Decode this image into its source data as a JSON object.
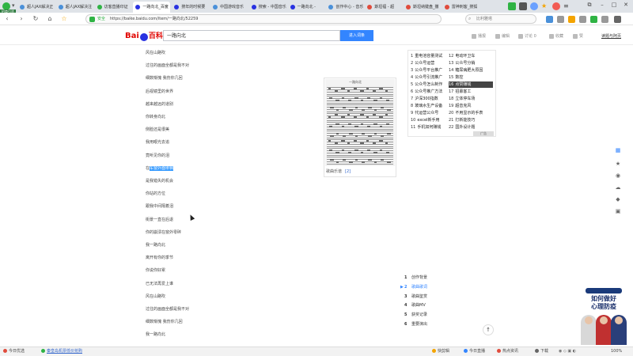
{
  "browser": {
    "badge": "招商引资",
    "tabs": [
      {
        "label": "超人JAX解决正",
        "active": false,
        "color": "#4a90d9"
      },
      {
        "label": "超人JAX解决注",
        "active": false,
        "color": "#4a90d9"
      },
      {
        "label": "访客直播印证",
        "active": false,
        "color": "#2fb344"
      },
      {
        "label": "一路向北_百度",
        "active": true,
        "color": "#2932e1"
      },
      {
        "label": "搜年的时候要",
        "active": false,
        "color": "#2932e1"
      },
      {
        "label": "中国游戏音乐",
        "active": false,
        "color": "#4a90d9"
      },
      {
        "label": "搜索 - 中国音乐",
        "active": false,
        "color": "#2932e1"
      },
      {
        "label": "一路向北 - ",
        "active": false,
        "color": "#2932e1"
      },
      {
        "label": "创作中心 - 音乐",
        "active": false,
        "color": "#4a90d9"
      },
      {
        "label": "斯坦福 - 超",
        "active": false,
        "color": "#e04b3c"
      },
      {
        "label": "斯坦纳键盘_撒",
        "active": false,
        "color": "#e04b3c"
      },
      {
        "label": "雷神刺客_搜狐",
        "active": false,
        "color": "#e04b3c"
      }
    ],
    "url_secure": "安全",
    "url": "https://baike.baidu.com/item/一路向北/52259",
    "search_placeholder": "比利雅塔"
  },
  "header": {
    "logo_bai": "Bai",
    "logo_bk": "百科",
    "search_value": "一路向北",
    "search_button": "进入词条",
    "actions": [
      "播报",
      "编辑",
      "讨论 0",
      "收藏",
      "赞"
    ],
    "help": "读题与阿页"
  },
  "lyrics": [
    {
      "text": "风在山路吹"
    },
    {
      "text": "过往的画面全都是我不对"
    },
    {
      "text": "细数惭愧 我伤你几回"
    },
    {
      "text": "后视镜里的世界"
    },
    {
      "text": "越来越远的道别"
    },
    {
      "text": "你转身向北"
    },
    {
      "text": "侧脸还是很美"
    },
    {
      "text": "我用眼光去追"
    },
    {
      "text": "竟听见你的泪"
    },
    {
      "text": "在车窗外面徘徊",
      "before": "在",
      "highlight": "车窗外面徘徊"
    },
    {
      "text": "是我错失的机会"
    },
    {
      "text": "你站的方位"
    },
    {
      "text": "跟我中间隔着泪"
    },
    {
      "text": "街景一直在后退"
    },
    {
      "text": "你的崩溃在窗外零碎"
    },
    {
      "text": "我一路向北"
    },
    {
      "text": "离开有你的季节"
    },
    {
      "text": "你说你好累"
    },
    {
      "text": "已无法再爱上谁"
    },
    {
      "text": "风在山路吹"
    },
    {
      "text": "过往的画面全都是我不对"
    },
    {
      "text": "细数惭愧 我伤你几回"
    },
    {
      "text": "我一路向北"
    }
  ],
  "sheet": {
    "title": "一路向北",
    "caption": "歌曲乐谱",
    "cite": "[2]"
  },
  "hotlist": {
    "left": [
      {
        "num": "1",
        "label": "重电池容量测试"
      },
      {
        "num": "2",
        "label": "公众号运营"
      },
      {
        "num": "3",
        "label": "公众号平台推广"
      },
      {
        "num": "4",
        "label": "公众号引流推广"
      },
      {
        "num": "5",
        "label": "公众号怎么制作"
      },
      {
        "num": "6",
        "label": "公众号推广方法"
      },
      {
        "num": "7",
        "label": "沪深300指数"
      },
      {
        "num": "8",
        "label": "玻璃水生产设备"
      },
      {
        "num": "9",
        "label": "代运营公众号"
      },
      {
        "num": "10",
        "label": "excel新手用"
      },
      {
        "num": "11",
        "label": "手机如何赚钱"
      }
    ],
    "right": [
      {
        "num": "12",
        "label": "电动环卫车"
      },
      {
        "num": "13",
        "label": "公众号分销"
      },
      {
        "num": "14",
        "label": "糖尿病肥大原因"
      },
      {
        "num": "15",
        "label": "数控"
      },
      {
        "num": "16",
        "label": "点赞赚钱",
        "hilite": true
      },
      {
        "num": "17",
        "label": "招募客工"
      },
      {
        "num": "18",
        "label": "立体停车场"
      },
      {
        "num": "19",
        "label": "超音克风"
      },
      {
        "num": "20",
        "label": "不用显示的手表"
      },
      {
        "num": "21",
        "label": "打新能技巧"
      },
      {
        "num": "22",
        "label": "国外设计题"
      }
    ],
    "more": "广告"
  },
  "toc": [
    {
      "num": "1",
      "label": "创作背景"
    },
    {
      "num": "2",
      "label": "歌曲歌词",
      "active": true
    },
    {
      "num": "3",
      "label": "歌曲鉴赏"
    },
    {
      "num": "4",
      "label": "歌曲MV"
    },
    {
      "num": "5",
      "label": "获奖记录"
    },
    {
      "num": "6",
      "label": "重要演出"
    }
  ],
  "ad": {
    "line1": "如何做好",
    "line2": "心理防疫"
  },
  "statusbar": {
    "left1": "今日优选",
    "left2": "秦皇岛机票低价抢购",
    "right": [
      "快剪辑",
      "今日直播",
      "热点资讯",
      "下载",
      "100%"
    ]
  }
}
